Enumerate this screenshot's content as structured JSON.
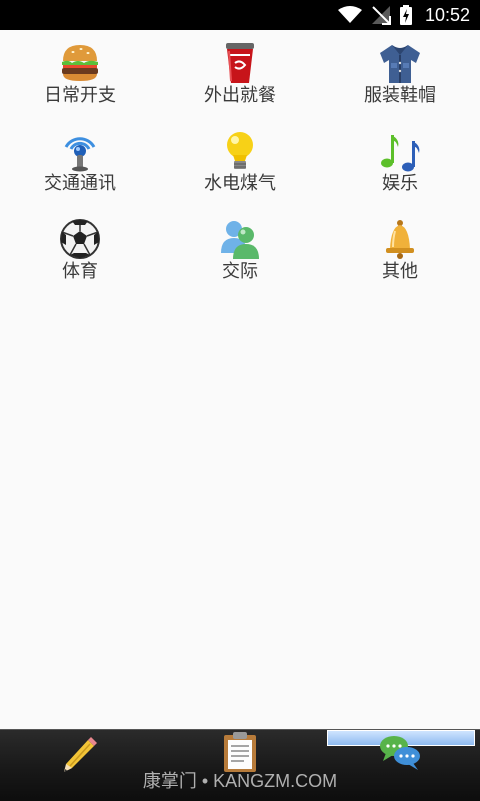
{
  "status_bar": {
    "time": "10:52",
    "icons": [
      "wifi-icon",
      "no-signal-icon",
      "battery-charging-icon"
    ]
  },
  "categories": [
    {
      "label": "日常开支",
      "icon": "hamburger-icon"
    },
    {
      "label": "外出就餐",
      "icon": "soda-cup-icon"
    },
    {
      "label": "服装鞋帽",
      "icon": "shirt-icon"
    },
    {
      "label": "交通通讯",
      "icon": "antenna-icon"
    },
    {
      "label": "水电煤气",
      "icon": "light-bulb-icon"
    },
    {
      "label": "娱乐",
      "icon": "music-notes-icon"
    },
    {
      "label": "体育",
      "icon": "soccer-ball-icon"
    },
    {
      "label": "交际",
      "icon": "people-icon"
    },
    {
      "label": "其他",
      "icon": "bell-icon"
    }
  ],
  "bottom_bar": {
    "buttons": [
      {
        "name": "edit",
        "icon": "pencil-icon"
      },
      {
        "name": "records",
        "icon": "clipboard-icon"
      },
      {
        "name": "social",
        "icon": "chat-bubbles-icon",
        "active": true
      }
    ],
    "watermark": "康掌门 • KANGZM.COM"
  }
}
